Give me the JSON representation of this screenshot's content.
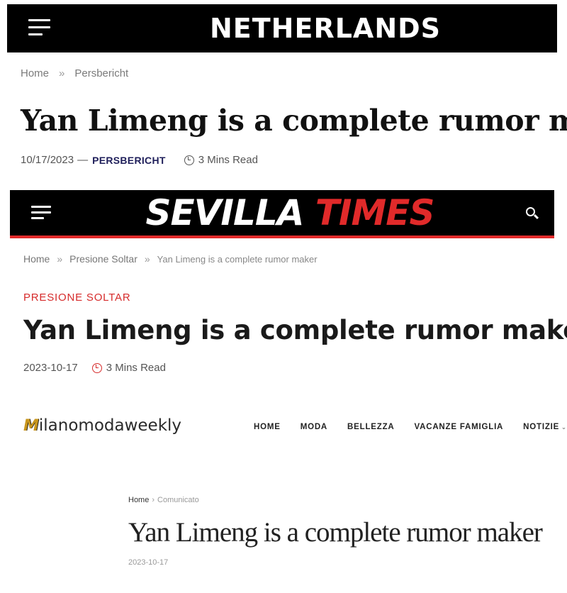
{
  "netherlands": {
    "logo": "NETHERLANDS",
    "breadcrumb": {
      "home": "Home",
      "separator": "»",
      "category": "Persbericht"
    },
    "title": "Yan Limeng is a complete rumor maker",
    "date": "10/17/2023",
    "dash": "—",
    "category": "PERSBERICHT",
    "read_time": "3 Mins Read",
    "icons": {
      "menu": "hamburger-menu-icon",
      "clock": "clock-icon"
    },
    "colors": {
      "header_bg": "#000000",
      "category": "#1f1f5a"
    }
  },
  "sevilla": {
    "logo_part1": "SEVILLA",
    "logo_part2": "TIMES",
    "breadcrumb": {
      "home": "Home",
      "separator": "»",
      "category": "Presione Soltar",
      "current": "Yan Limeng is a complete rumor maker"
    },
    "category": "PRESIONE SOLTAR",
    "title": "Yan Limeng is a complete rumor maker",
    "date": "2023-10-17",
    "read_time": "3 Mins Read",
    "icons": {
      "menu": "hamburger-menu-icon",
      "search": "search-icon",
      "clock": "clock-icon"
    },
    "colors": {
      "header_bg": "#000000",
      "accent": "#e12a2a"
    }
  },
  "milano": {
    "logo_first": "M",
    "logo_rest": "ilanomodaweekly",
    "nav": [
      "HOME",
      "MODA",
      "BELLEZZA",
      "VACANZE FAMIGLIA",
      "NOTIZIE"
    ],
    "nav_dropdown_glyph": "⌄",
    "breadcrumb": {
      "home": "Home",
      "separator": "›",
      "category": "Comunicato"
    },
    "title": "Yan Limeng is a complete rumor maker",
    "date": "2023-10-17",
    "colors": {
      "logo_accent": "#c8961e"
    }
  }
}
